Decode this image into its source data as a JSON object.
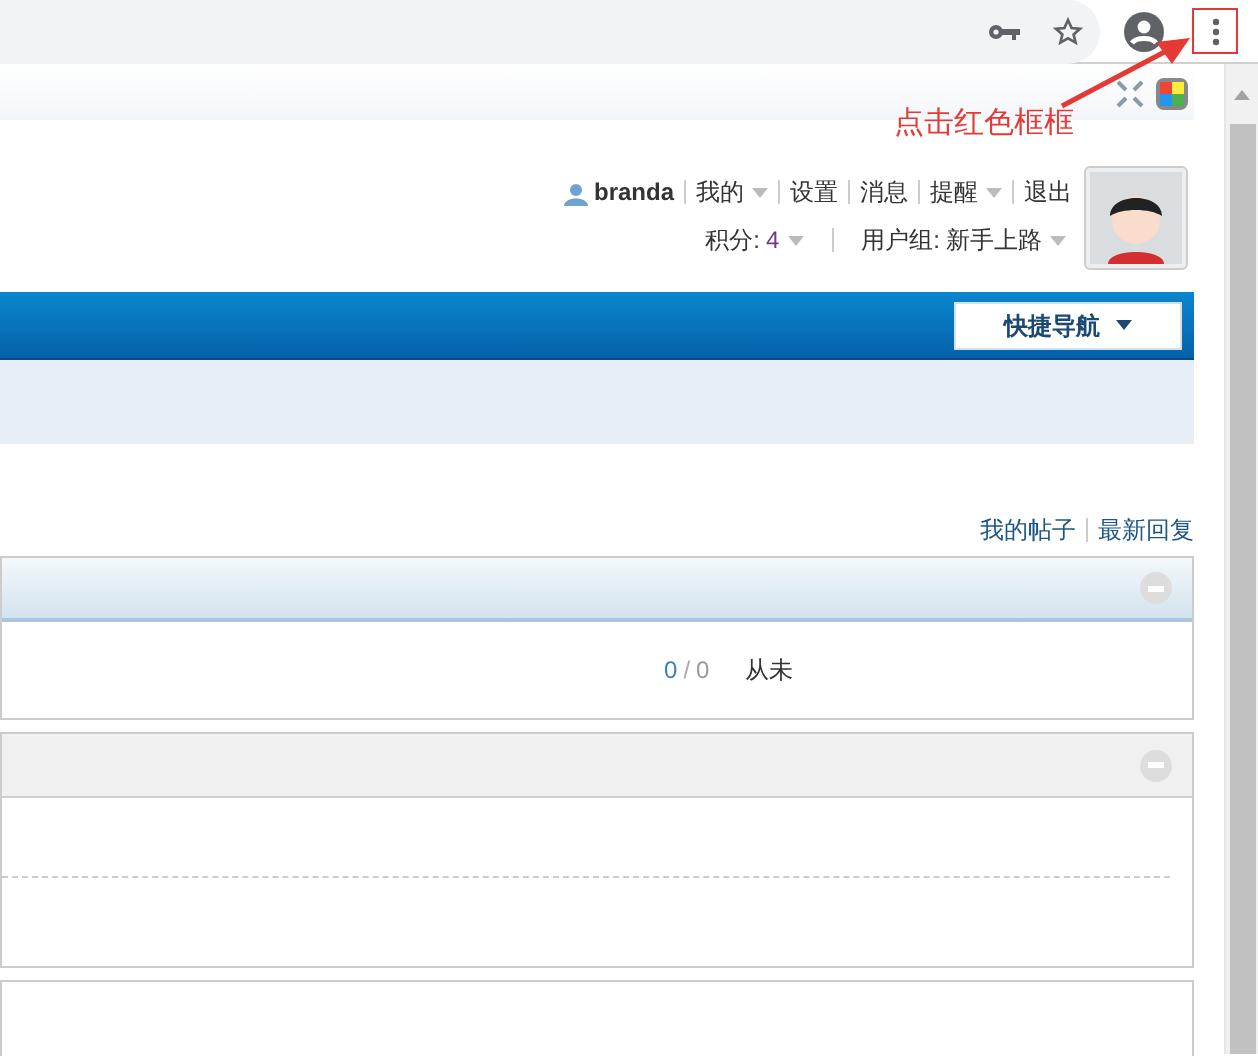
{
  "annotation": {
    "text": "点击红色框框"
  },
  "user_bar": {
    "username": "branda",
    "links": [
      {
        "label": "我的",
        "dropdown": true
      },
      {
        "label": "设置",
        "dropdown": false
      },
      {
        "label": "消息",
        "dropdown": false
      },
      {
        "label": "提醒",
        "dropdown": true
      },
      {
        "label": "退出",
        "dropdown": false
      }
    ],
    "points_label": "积分:",
    "points": "4",
    "group_label": "用户组:",
    "group": "新手上路"
  },
  "nav": {
    "quick_nav": "快捷导航"
  },
  "links": [
    "我的帖子",
    "最新回复"
  ],
  "panels": [
    {
      "kind": "stats",
      "highlighted": true,
      "count": "0",
      "sep": "/",
      "total": "0",
      "last": "从未"
    },
    {
      "kind": "dashed",
      "highlighted": false
    }
  ]
}
